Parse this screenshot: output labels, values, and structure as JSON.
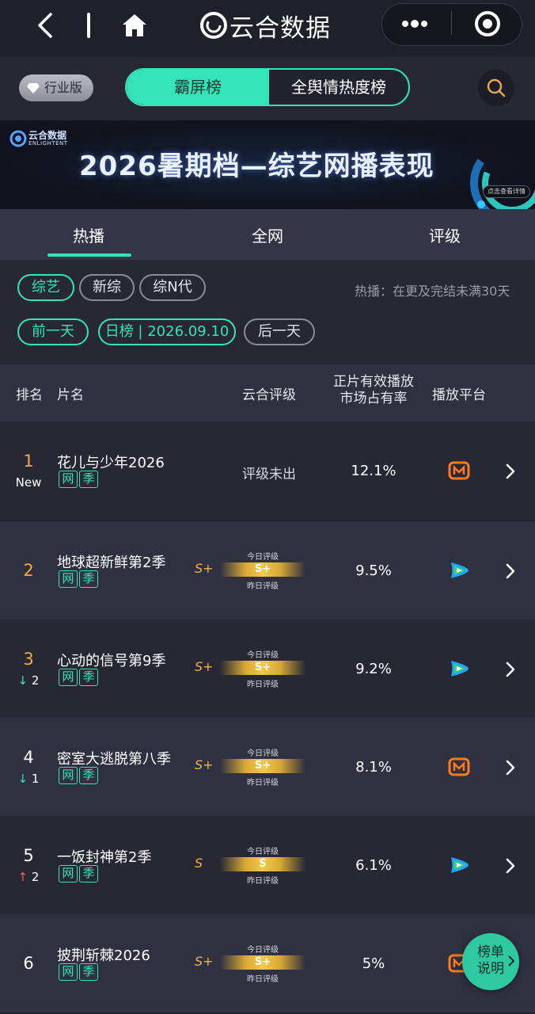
{
  "nav": {
    "title": "云合数据"
  },
  "header": {
    "edition_badge": "行业版",
    "segment_active": "霸屏榜",
    "segment_inactive": "全舆情热度榜"
  },
  "banner": {
    "brand_cn": "云合数据",
    "brand_en": "ENLIGHTENT",
    "title": "2026暑期档—综艺网播表现",
    "detail_button": "点击查看详情"
  },
  "tabs": [
    "热播",
    "全网",
    "评级"
  ],
  "filters": {
    "category_chips": [
      "综艺",
      "新综",
      "综N代"
    ],
    "hint": "热播：在更及完结未满30天",
    "prev_day": "前一天",
    "date_chip": "日榜 | 2026.09.10",
    "next_day": "后一天"
  },
  "table_header": {
    "rank": "排名",
    "name": "片名",
    "rating": "云合评级",
    "share_line1": "正片有效播放",
    "share_line2": "市场占有率",
    "platform": "播放平台"
  },
  "grade_labels": {
    "today": "今日评级",
    "yesterday": "昨日评级"
  },
  "rows": [
    {
      "rank": "1",
      "badge": "New",
      "trend_dir": "",
      "trend_val": "",
      "title": "花儿与少年2026",
      "tags": [
        "网",
        "季"
      ],
      "rating_text": "评级未出",
      "grade": "",
      "share": "12.1%",
      "platform": "mango-tv"
    },
    {
      "rank": "2",
      "badge": "",
      "trend_dir": "",
      "trend_val": "",
      "title": "地球超新鲜第2季",
      "tags": [
        "网",
        "季"
      ],
      "rating_text": "",
      "grade": "S+",
      "share": "9.5%",
      "platform": "tencent-video"
    },
    {
      "rank": "3",
      "badge": "",
      "trend_dir": "down",
      "trend_val": "2",
      "title": "心动的信号第9季",
      "tags": [
        "网",
        "季"
      ],
      "rating_text": "",
      "grade": "S+",
      "share": "9.2%",
      "platform": "tencent-video"
    },
    {
      "rank": "4",
      "badge": "",
      "trend_dir": "down",
      "trend_val": "1",
      "title": "密室大逃脱第八季",
      "tags": [
        "网",
        "季"
      ],
      "rating_text": "",
      "grade": "S+",
      "share": "8.1%",
      "platform": "mango-tv"
    },
    {
      "rank": "5",
      "badge": "",
      "trend_dir": "up",
      "trend_val": "2",
      "title": "一饭封神第2季",
      "tags": [
        "网",
        "季"
      ],
      "rating_text": "",
      "grade": "S",
      "share": "6.1%",
      "platform": "tencent-video"
    },
    {
      "rank": "6",
      "badge": "",
      "trend_dir": "",
      "trend_val": "",
      "title": "披荆斩棘2026",
      "tags": [
        "网",
        "季"
      ],
      "rating_text": "",
      "grade": "S+",
      "share": "5%",
      "platform": "mango-tv"
    }
  ],
  "float_button": {
    "line1": "榜单",
    "line2": "说明"
  },
  "colors": {
    "accent": "#35e3b8",
    "rank_top": "#f2a84a",
    "trend_up": "#ff5a4a",
    "grade_gold": "#f2b24c"
  }
}
